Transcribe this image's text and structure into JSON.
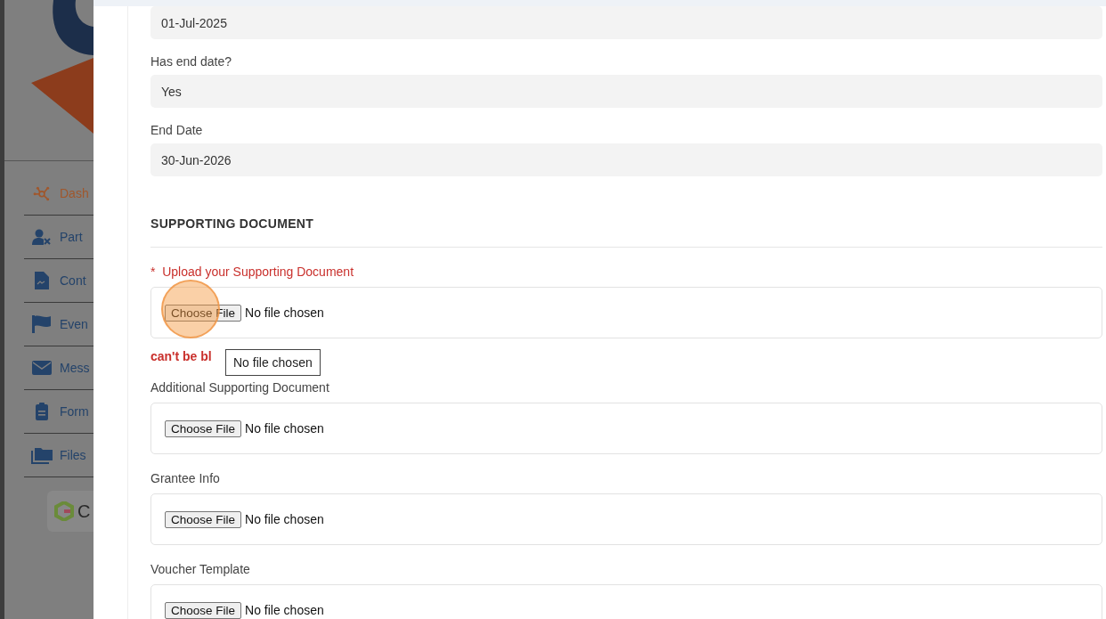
{
  "sidebar": {
    "items": [
      {
        "label": "Dash",
        "selected": true
      },
      {
        "label": "Part",
        "selected": false
      },
      {
        "label": "Cont",
        "selected": false
      },
      {
        "label": "Even",
        "selected": false
      },
      {
        "label": "Mess",
        "selected": false
      },
      {
        "label": "Form",
        "selected": false
      },
      {
        "label": "Files",
        "selected": false
      }
    ],
    "app_button": {
      "label": "C"
    }
  },
  "form": {
    "fields": [
      {
        "value": "01-Jul-2025"
      },
      {
        "label": "Has end date?",
        "value": "Yes"
      },
      {
        "label": "End Date",
        "value": "30-Jun-2026"
      }
    ],
    "section": "SUPPORTING DOCUMENT",
    "uploads": [
      {
        "marker": "*",
        "label": "Upload your Supporting Document",
        "required": true,
        "button": "Choose File",
        "status": "No file chosen",
        "highlighted": true,
        "error": "can't be bl",
        "tooltip": "No file chosen"
      },
      {
        "label": "Additional Supporting Document",
        "required": false,
        "button": "Choose File",
        "status": "No file chosen",
        "highlighted": false
      },
      {
        "label": "Grantee Info",
        "required": false,
        "button": "Choose File",
        "status": "No file chosen",
        "highlighted": false
      },
      {
        "label": "Voucher Template",
        "required": false,
        "button": "Choose File",
        "status": "No file chosen",
        "highlighted": false
      }
    ]
  }
}
